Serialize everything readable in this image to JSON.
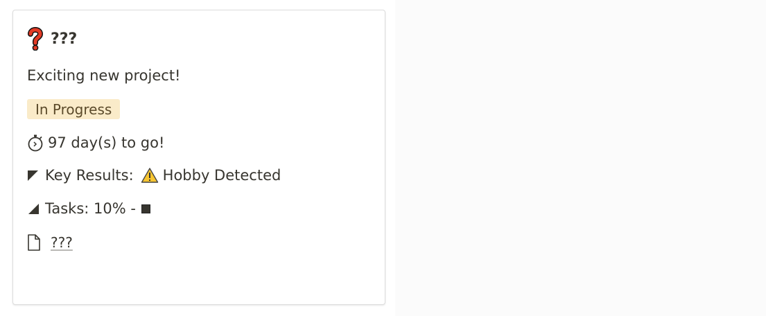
{
  "card": {
    "title": "???",
    "description": "Exciting new project!",
    "status": "In Progress",
    "status_color": "#faebc9",
    "countdown": "97 day(s) to go!",
    "key_results_label": "Key Results:",
    "key_results_value": "Hobby Detected",
    "tasks_label": "Tasks: 10% -",
    "page_link": "???",
    "icons": {
      "title": "question-mark-icon",
      "countdown": "stopwatch-icon",
      "key_results": "triangle-corner-icon",
      "warning": "warning-icon",
      "tasks": "triangle-corner-icon",
      "page": "page-icon"
    }
  }
}
